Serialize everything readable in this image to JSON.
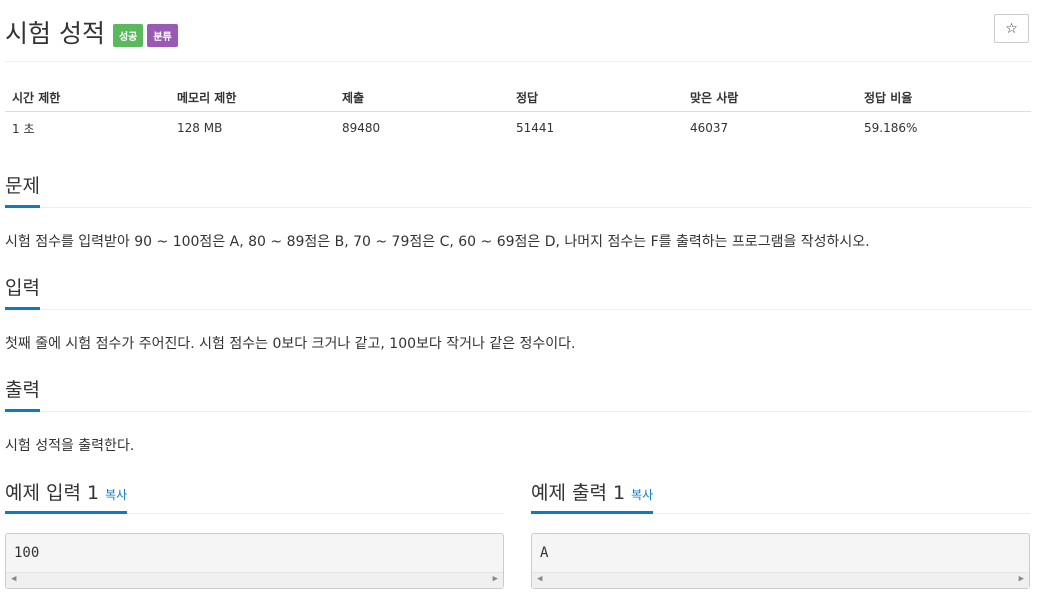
{
  "problem": {
    "title": "시험 성적",
    "badges": {
      "success": "성공",
      "category": "분류"
    },
    "star_icon": "☆"
  },
  "info_table": {
    "headers": [
      "시간 제한",
      "메모리 제한",
      "제출",
      "정답",
      "맞은 사람",
      "정답 비율"
    ],
    "values": [
      "1 초",
      "128 MB",
      "89480",
      "51441",
      "46037",
      "59.186%"
    ]
  },
  "sections": {
    "description": {
      "heading": "문제",
      "text": "시험 점수를 입력받아 90 ~ 100점은 A, 80 ~ 89점은 B, 70 ~ 79점은 C, 60 ~ 69점은 D, 나머지 점수는 F를 출력하는 프로그램을 작성하시오."
    },
    "input": {
      "heading": "입력",
      "text": "첫째 줄에 시험 점수가 주어진다. 시험 점수는 0보다 크거나 같고, 100보다 작거나 같은 정수이다."
    },
    "output": {
      "heading": "출력",
      "text": "시험 성적을 출력한다."
    }
  },
  "examples": {
    "input": {
      "heading": "예제 입력 1",
      "copy": "복사",
      "value": "100"
    },
    "output": {
      "heading": "예제 출력 1",
      "copy": "복사",
      "value": "A"
    }
  },
  "scroll_arrows": {
    "left": "◀",
    "right": "▶"
  },
  "colors": {
    "accent": "#0e7abf",
    "success_badge": "#5cb85c",
    "category_badge": "#9b59b6"
  }
}
